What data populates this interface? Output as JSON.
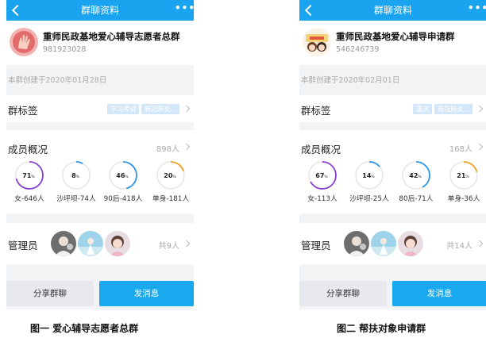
{
  "colors": {
    "accent": "#1aa4f0",
    "send_button": "#18a9ee",
    "ring_purple": "#8a3fd8",
    "ring_blue": "#2b94ea",
    "ring_orange": "#f0a020",
    "ring_track": "#e6e6e6"
  },
  "phones": [
    {
      "title": "群聊资料",
      "more": "•••",
      "group_name": "重师民政基地爱心辅导志愿者总群",
      "group_id": "981923028",
      "created": "本群创建于2020年01月28日",
      "tags_label": "群标签",
      "tags": [
        "学习考试",
        "新冠肺炎..."
      ],
      "members_label": "成员概况",
      "members_count": "898人",
      "rings": [
        {
          "value": "71",
          "unit": "%",
          "caption": "女-646人",
          "pct": 0.71,
          "color": "purple"
        },
        {
          "value": "8",
          "unit": "%",
          "caption": "沙坪坝-74人",
          "pct": 0.08,
          "color": "blue"
        },
        {
          "value": "46",
          "unit": "%",
          "caption": "90后-418人",
          "pct": 0.46,
          "color": "blue"
        },
        {
          "value": "20",
          "unit": "%",
          "caption": "单身-181人",
          "pct": 0.2,
          "color": "orange"
        }
      ],
      "admins_label": "管理员",
      "admins_count": "共9人",
      "share_label": "分享群聊",
      "send_label": "发消息",
      "caption": "图一  爱心辅导志愿者总群"
    },
    {
      "title": "群聊资料",
      "more": "•••",
      "group_name": "重师民政基地爱心辅导申请群",
      "group_id": "546246739",
      "created": "本群创建于2020年02月01日",
      "tags_label": "群标签",
      "tags": [
        "重庆",
        "新冠肺炎..."
      ],
      "members_label": "成员概况",
      "members_count": "168人",
      "rings": [
        {
          "value": "67",
          "unit": "%",
          "caption": "女-113人",
          "pct": 0.67,
          "color": "purple"
        },
        {
          "value": "14",
          "unit": "%",
          "caption": "沙坪坝-25人",
          "pct": 0.14,
          "color": "blue"
        },
        {
          "value": "42",
          "unit": "%",
          "caption": "80后-71人",
          "pct": 0.42,
          "color": "blue"
        },
        {
          "value": "21",
          "unit": "%",
          "caption": "单身-36人",
          "pct": 0.21,
          "color": "orange"
        }
      ],
      "admins_label": "管理员",
      "admins_count": "共14人",
      "share_label": "分享群聊",
      "send_label": "发消息",
      "caption": "图二  帮扶对象申请群"
    }
  ]
}
